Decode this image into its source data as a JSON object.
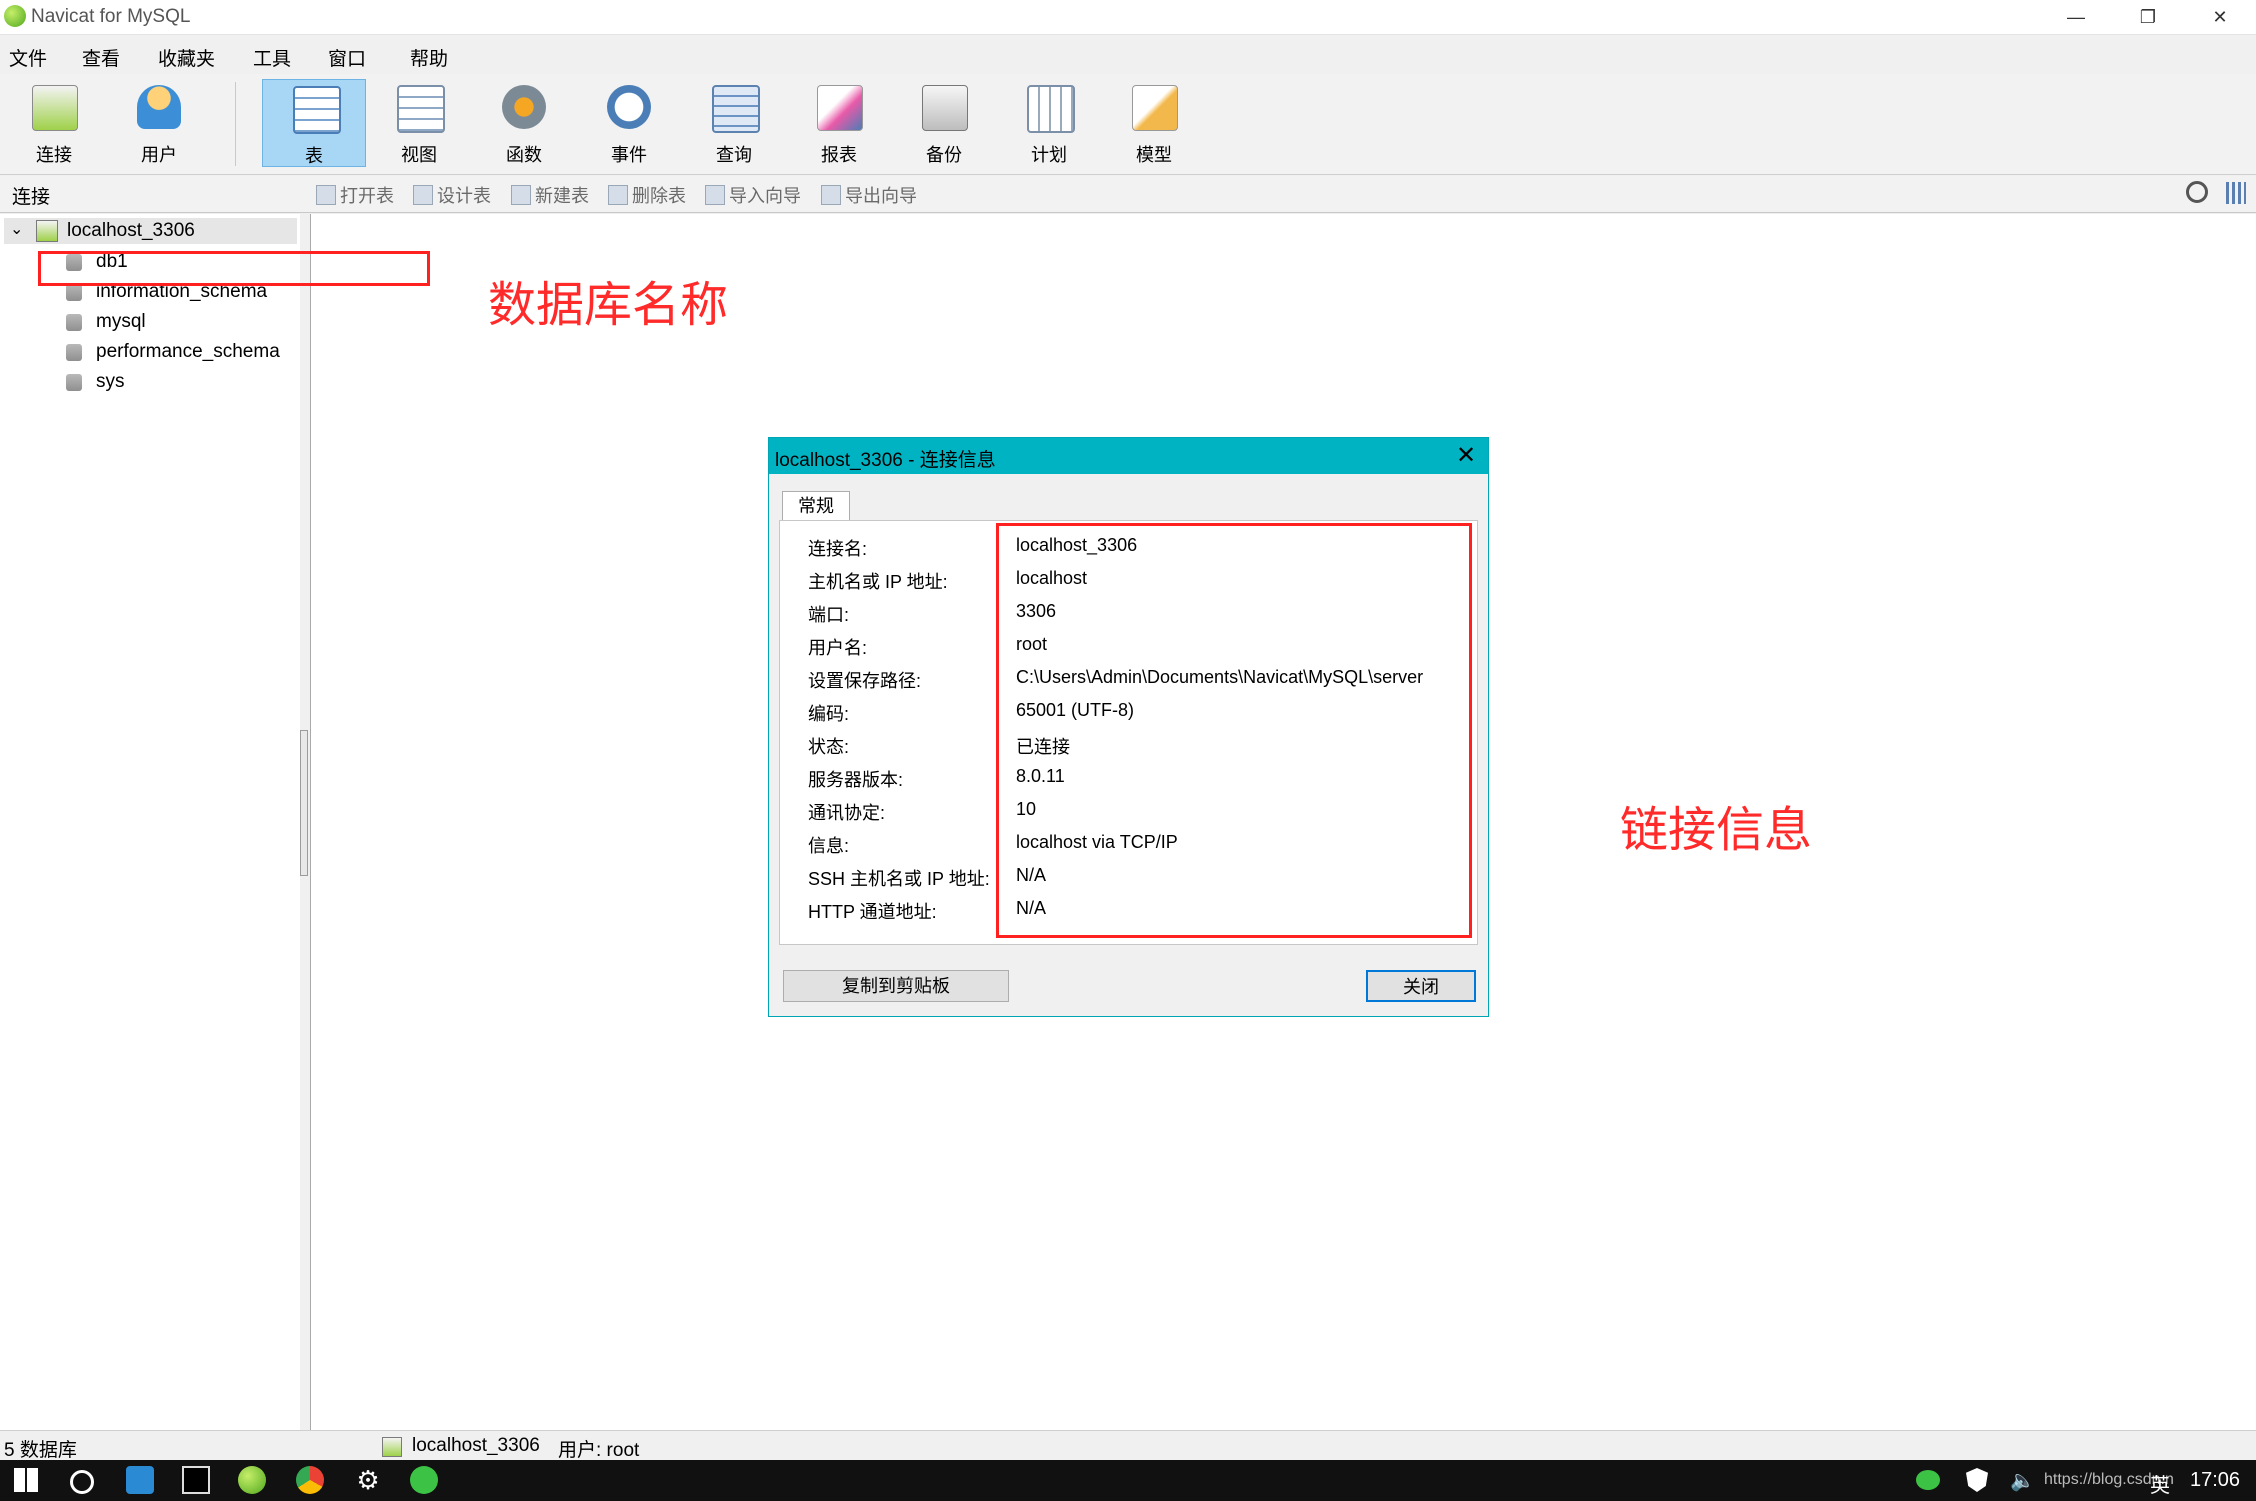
{
  "window": {
    "title": "Navicat for MySQL",
    "min": "—",
    "restore": "❐",
    "close": "✕"
  },
  "menu": [
    "文件",
    "查看",
    "收藏夹",
    "工具",
    "窗口",
    "帮助"
  ],
  "toolbar": {
    "connect": "连接",
    "user": "用户",
    "table": "表",
    "view": "视图",
    "function": "函数",
    "event": "事件",
    "query": "查询",
    "report": "报表",
    "backup": "备份",
    "schedule": "计划",
    "model": "模型"
  },
  "subbar": {
    "header": "连接",
    "open_table": "打开表",
    "design_table": "设计表",
    "new_table": "新建表",
    "delete_table": "删除表",
    "import_wizard": "导入向导",
    "export_wizard": "导出向导"
  },
  "tree": {
    "connection": "localhost_3306",
    "databases": [
      "db1",
      "information_schema",
      "mysql",
      "performance_schema",
      "sys"
    ]
  },
  "annotations": {
    "db_name": "数据库名称",
    "conn_info": "链接信息"
  },
  "dialog": {
    "title": "localhost_3306 - 连接信息",
    "tab": "常规",
    "fields": [
      {
        "label": "连接名:",
        "value": "localhost_3306"
      },
      {
        "label": "主机名或 IP 地址:",
        "value": "localhost"
      },
      {
        "label": "端口:",
        "value": "3306"
      },
      {
        "label": "用户名:",
        "value": "root"
      },
      {
        "label": "设置保存路径:",
        "value": "C:\\Users\\Admin\\Documents\\Navicat\\MySQL\\server"
      },
      {
        "label": "编码:",
        "value": "65001 (UTF-8)"
      },
      {
        "label": "状态:",
        "value": "已连接"
      },
      {
        "label": "服务器版本:",
        "value": "8.0.11"
      },
      {
        "label": "通讯协定:",
        "value": "10"
      },
      {
        "label": "信息:",
        "value": "localhost via TCP/IP"
      },
      {
        "label": "SSH 主机名或 IP 地址:",
        "value": "N/A"
      },
      {
        "label": "HTTP 通道地址:",
        "value": "N/A"
      }
    ],
    "copy_button": "复制到剪贴板",
    "close_button": "关闭"
  },
  "status": {
    "db_count": "5 数据库",
    "connection": "localhost_3306",
    "user": "用户: root"
  },
  "tray": {
    "url_text": "https://blog.csdn.net/...",
    "lang": "英",
    "time": "17:06"
  }
}
